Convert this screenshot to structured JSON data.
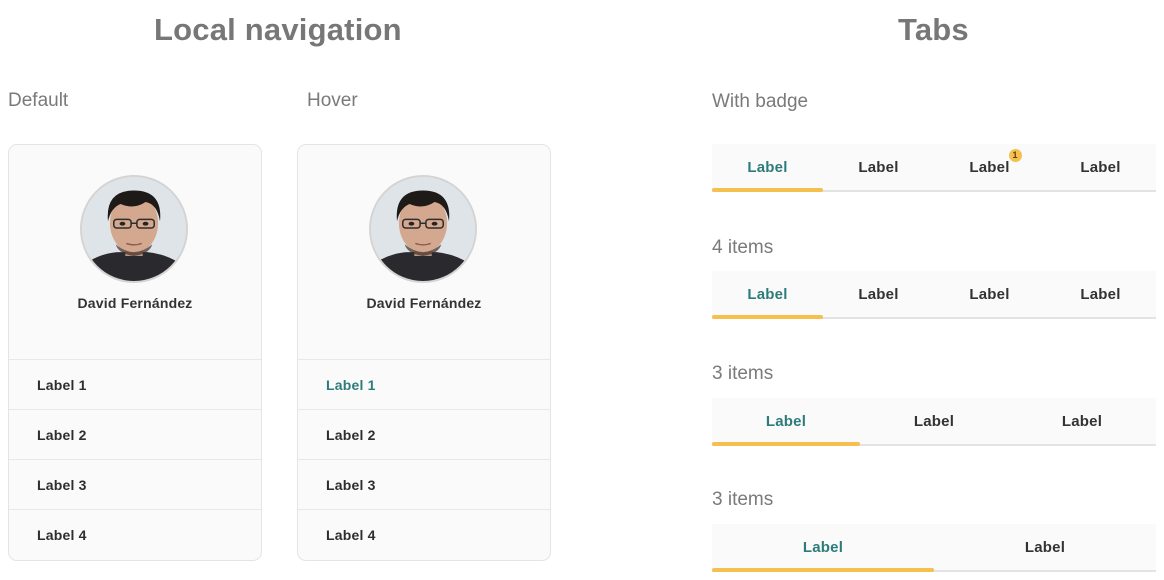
{
  "local_navigation": {
    "title": "Local navigation",
    "default_label": "Default",
    "hover_label": "Hover",
    "user_name": "David Fernández",
    "items": [
      "Label 1",
      "Label 2",
      "Label 3",
      "Label 4"
    ],
    "hover_active_index": 0,
    "accent_color": "#2e7b7b"
  },
  "tabs": {
    "title": "Tabs",
    "accent_color": "#2e7b7b",
    "indicator_color": "#f5c04f",
    "groups": [
      {
        "label": "With badge",
        "tabs": [
          "Label",
          "Label",
          "Label",
          "Label"
        ],
        "active_index": 0,
        "badge": {
          "tab_index": 2,
          "value": "1"
        }
      },
      {
        "label": "4 items",
        "tabs": [
          "Label",
          "Label",
          "Label",
          "Label"
        ],
        "active_index": 0
      },
      {
        "label": "3 items",
        "tabs": [
          "Label",
          "Label",
          "Label"
        ],
        "active_index": 0
      },
      {
        "label": "3 items",
        "tabs": [
          "Label",
          "Label"
        ],
        "active_index": 0
      }
    ]
  }
}
